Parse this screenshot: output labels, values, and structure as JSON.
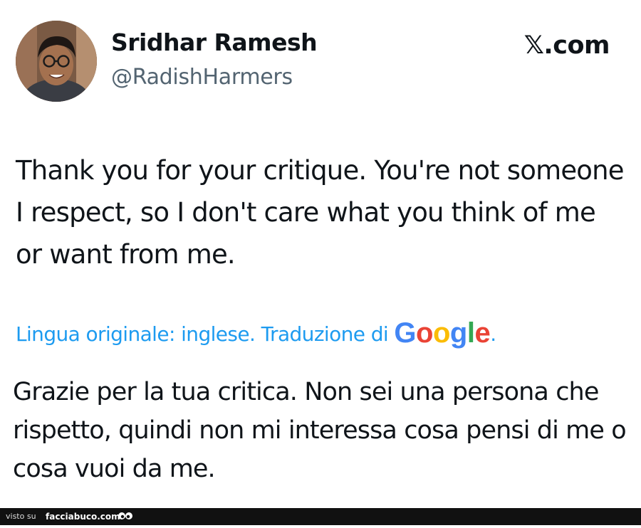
{
  "author": {
    "name": "Sridhar Ramesh",
    "handle": "@RadishHarmers"
  },
  "brand": "𝕏.com",
  "tweet_text": "Thank you for your critique. You're not someone I respect, so I don't care what you think of me or want from me.",
  "translation_bar": {
    "label": "Lingua originale: inglese. Traduzione di",
    "provider_letters": [
      "G",
      "o",
      "o",
      "g",
      "l",
      "e"
    ],
    "provider_colors": [
      "#4285F4",
      "#EA4335",
      "#FBBC05",
      "#4285F4",
      "#34A853",
      "#EA4335"
    ],
    "suffix": "."
  },
  "translated_text": "Grazie per la tua critica. Non sei una persona che rispetto, quindi non mi interessa cosa pensi di me o cosa vuoi da me.",
  "footer": {
    "visto_label": "visto su",
    "site": "facciabuco.com"
  },
  "colors": {
    "link": "#1d9bf0",
    "secondary_text": "#536471",
    "primary_text": "#0f1419"
  }
}
